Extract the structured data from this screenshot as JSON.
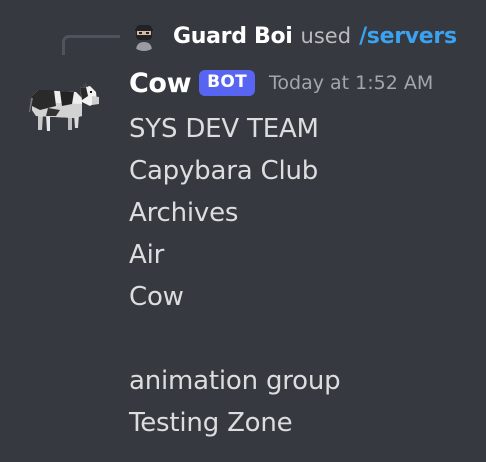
{
  "reply": {
    "username": "Guard Boi",
    "used_text": "used",
    "command": "/servers"
  },
  "message": {
    "username": "Cow",
    "bot_tag": "BOT",
    "timestamp": "Today at 1:52 AM",
    "lines": [
      "SYS DEV TEAM",
      "Capybara Club",
      "Archives",
      "Air",
      "Cow",
      "",
      "animation group",
      "Testing Zone"
    ]
  },
  "colors": {
    "background": "#36393f",
    "username": "#ffffff",
    "command": "#3ba2f0",
    "bot_tag": "#5865f2",
    "timestamp": "#a3a6aa",
    "text": "#dcddde"
  },
  "icons": {
    "reply_avatar": "ninja-avatar-icon",
    "message_avatar": "cow-avatar-icon"
  }
}
